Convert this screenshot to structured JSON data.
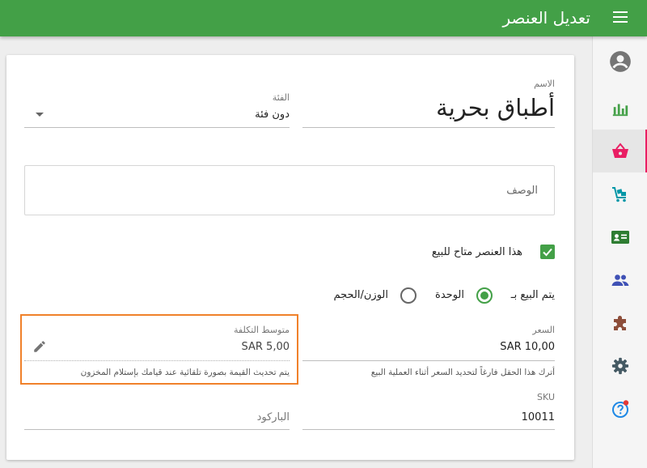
{
  "app": {
    "title": "تعديل العنصر",
    "accent": "#43a047",
    "highlight_color": "#f0812a"
  },
  "sidebar": {
    "items": [
      {
        "name": "account",
        "icon": "account-circle-icon",
        "color": "#757575"
      },
      {
        "name": "reports",
        "icon": "bar-chart-icon",
        "color": "#43a047"
      },
      {
        "name": "items",
        "icon": "basket-icon",
        "color": "#e91e63",
        "active": true
      },
      {
        "name": "inventory",
        "icon": "cart-icon",
        "color": "#0097a7"
      },
      {
        "name": "customers",
        "icon": "contact-card-icon",
        "color": "#2e7d32"
      },
      {
        "name": "employees",
        "icon": "people-icon",
        "color": "#3f51b5"
      },
      {
        "name": "apps",
        "icon": "puzzle-icon",
        "color": "#8d4e3a"
      },
      {
        "name": "settings",
        "icon": "gear-icon",
        "color": "#455a64"
      },
      {
        "name": "help",
        "icon": "help-icon",
        "color": "#1e88e5"
      }
    ]
  },
  "form": {
    "name_label": "الاسم",
    "name_value": "أطباق بحرية",
    "category_label": "الفئة",
    "category_value": "دون فئة",
    "description_placeholder": "الوصف",
    "available_label": "هذا العنصر متاح للبيع",
    "sold_by_label": "يتم البيع بـ",
    "sold_by_options": [
      "الوحدة",
      "الوزن/الحجم"
    ],
    "price_label": "السعر",
    "price_value": "SAR 10,00",
    "price_hint": "أترك هذا الحقل فارغاً لتحديد السعر أثناء العملية البيع",
    "cost_label": "متوسط التكلفة",
    "cost_value": "SAR 5,00",
    "cost_hint": "يتم تحديث القيمة بصورة تلقائية عند قيامك بإستلام المخزون",
    "sku_label": "SKU",
    "sku_value": "10011",
    "barcode_placeholder": "الباركود"
  }
}
